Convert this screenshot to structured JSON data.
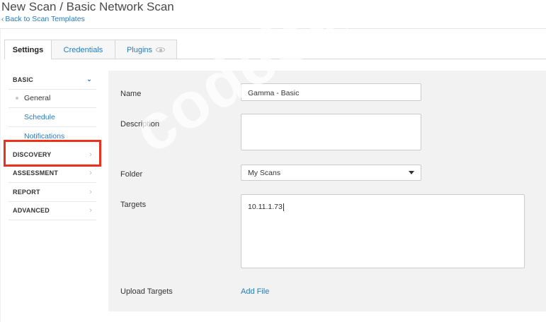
{
  "header": {
    "title": "New Scan / Basic Network Scan",
    "back_label": "Back to Scan Templates"
  },
  "tabs": [
    {
      "label": "Settings"
    },
    {
      "label": "Credentials"
    },
    {
      "label": "Plugins"
    }
  ],
  "sidebar": {
    "basic": "BASIC",
    "general": "General",
    "schedule": "Schedule",
    "notifications": "Notifications",
    "discovery": "DISCOVERY",
    "assessment": "ASSESSMENT",
    "report": "REPORT",
    "advanced": "ADVANCED"
  },
  "form": {
    "name_label": "Name",
    "name_value": "Gamma - Basic",
    "description_label": "Description",
    "description_value": "",
    "folder_label": "Folder",
    "folder_value": "My Scans",
    "targets_label": "Targets",
    "targets_value": "10.11.1.73",
    "upload_label": "Upload Targets",
    "add_file_label": "Add File"
  },
  "watermark": "codeby.net",
  "colors": {
    "accent": "#2a7ab8",
    "highlight": "#e8321e",
    "panel_bg": "#f2f2f2"
  }
}
